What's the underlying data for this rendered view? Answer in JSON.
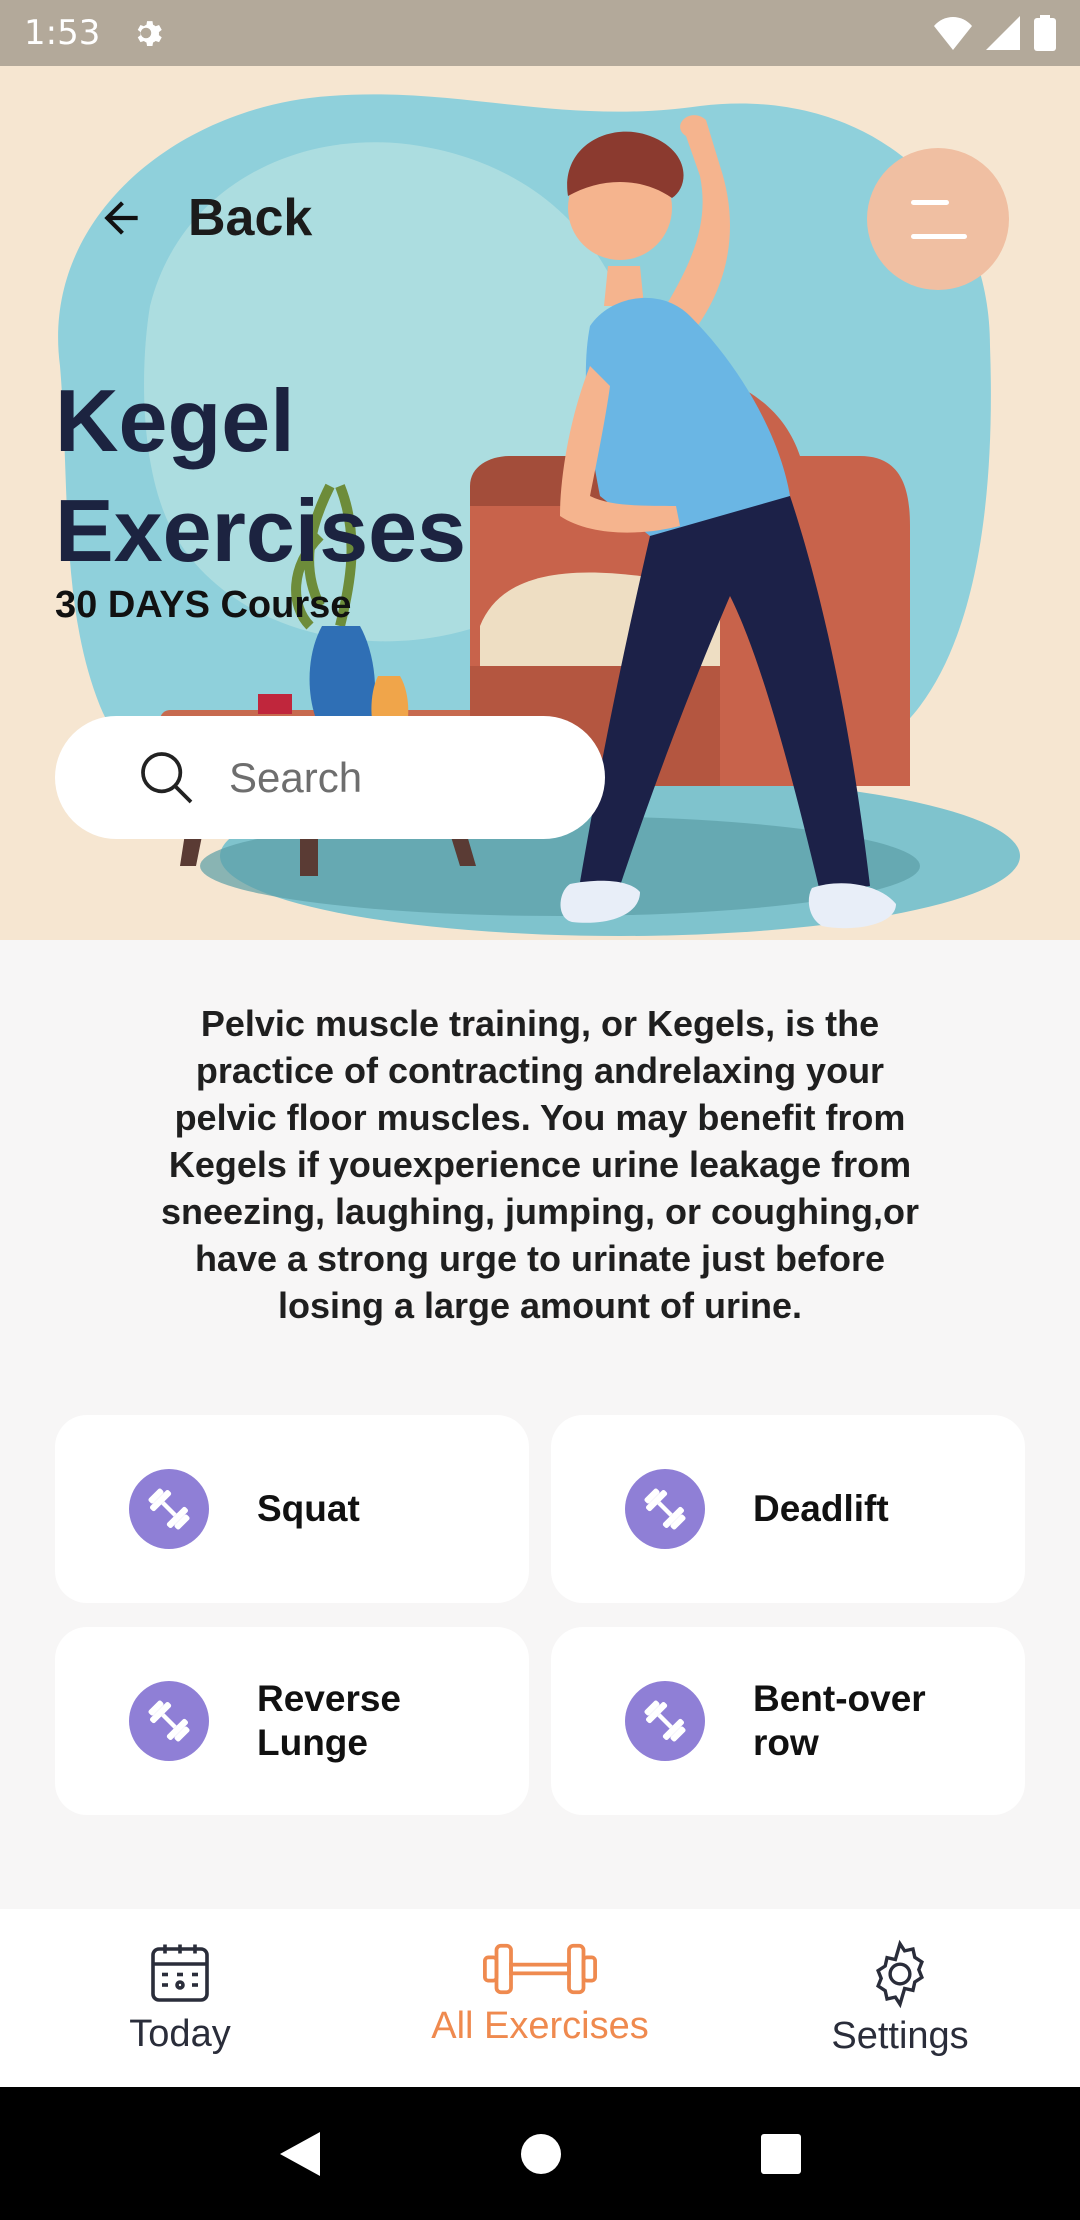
{
  "status_bar": {
    "time": "1:53"
  },
  "header": {
    "back_label": "Back"
  },
  "hero": {
    "title": "Kegel Exercises",
    "subtitle": "30 DAYS Course"
  },
  "search": {
    "placeholder": "Search",
    "value": ""
  },
  "description": "Pelvic muscle training, or Kegels, is the practice of contracting andrelaxing your pelvic floor muscles. You may benefit from Kegels if youexperience urine leakage from sneezing, laughing, jumping, or coughing,or have a strong urge to urinate just before losing a large amount of urine.",
  "exercises": [
    {
      "label": "Squat",
      "icon": "dumbbell-icon"
    },
    {
      "label": "Deadlift",
      "icon": "dumbbell-icon"
    },
    {
      "label": "Reverse Lunge",
      "icon": "dumbbell-icon"
    },
    {
      "label": "Bent-over row",
      "icon": "dumbbell-icon"
    }
  ],
  "bottom_nav": {
    "items": [
      {
        "label": "Today",
        "icon": "calendar-icon",
        "active": false
      },
      {
        "label": "All Exercises",
        "icon": "dumbbell-icon",
        "active": true
      },
      {
        "label": "Settings",
        "icon": "gear-icon",
        "active": false
      }
    ]
  },
  "colors": {
    "accent": "#ef8a4f",
    "icon_bg": "#8f7fd6",
    "hero_bg": "#f6e6d1",
    "title": "#1c2340"
  }
}
